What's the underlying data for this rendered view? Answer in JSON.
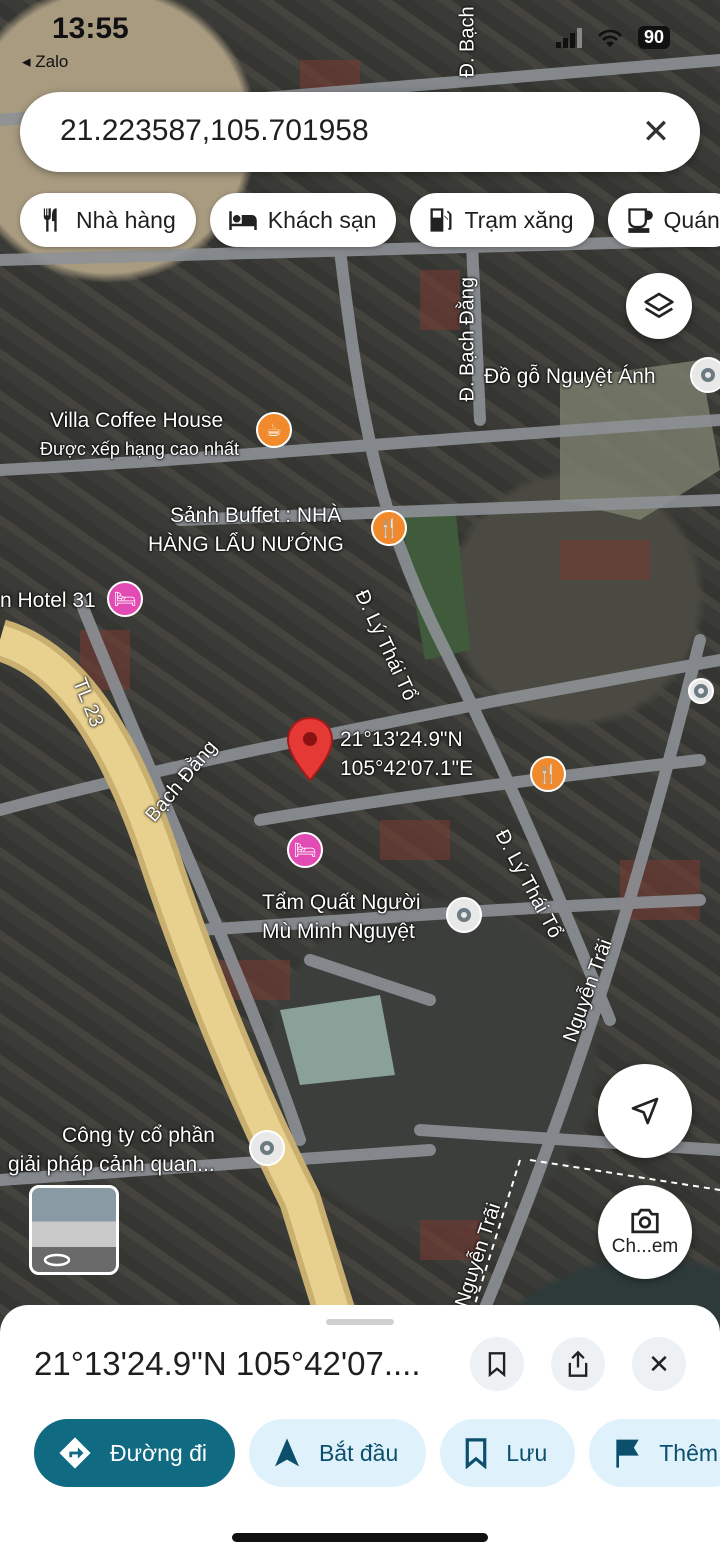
{
  "status_bar": {
    "time": "13:55",
    "back_app": "◂ Zalo",
    "battery": "90"
  },
  "search": {
    "query": "21.223587,105.701958"
  },
  "chips": [
    {
      "label": "Nhà hàng",
      "icon": "restaurant-icon"
    },
    {
      "label": "Khách sạn",
      "icon": "hotel-icon"
    },
    {
      "label": "Trạm xăng",
      "icon": "gas-station-icon"
    },
    {
      "label": "Quán",
      "icon": "cafe-icon"
    }
  ],
  "map": {
    "pin_label": [
      "21°13'24.9\"N",
      "105°42'07.1\"E"
    ],
    "places": [
      {
        "name": "Villa Coffee House",
        "sub": "Được xếp hạng cao nhất"
      },
      {
        "name": "Sảnh Buffet : NHÀ",
        "sub": "HÀNG LẨU NƯỚNG"
      },
      {
        "name": "n Hotel 31"
      },
      {
        "name": "Đồ gỗ Nguyệt Ánh"
      },
      {
        "name": "Tẩm Quất Người",
        "sub": "Mù Minh Nguyệt"
      },
      {
        "name": "Công ty cổ phần",
        "sub": "giải pháp cảnh quan..."
      }
    ],
    "roads": {
      "bach_dang_top": "Đ. Bạch Đằng",
      "bach_dang_top2": "Đ. Bạch",
      "ly_thai_to_1": "Đ. Lý Thái Tổ",
      "ly_thai_to_2": "Đ. Lý Thái Tổ",
      "tl23": "TL 23",
      "bach_dang": "Bạch Đằng",
      "nguyen_trai_1": "Nguyễn Trãi",
      "nguyen_trai_2": "Nguyễn Trãi"
    }
  },
  "lens_label": "Ch...em",
  "sheet": {
    "title": "21°13'24.9\"N 105°42'07....",
    "actions": [
      {
        "label": "Đường đi",
        "icon": "directions-icon"
      },
      {
        "label": "Bắt đầu",
        "icon": "navigation-icon"
      },
      {
        "label": "Lưu",
        "icon": "bookmark-icon"
      },
      {
        "label": "Thêm",
        "icon": "flag-icon"
      }
    ]
  },
  "colors": {
    "accent": "#0f6a82",
    "action_bg": "#dff2fb",
    "pin": "#e53935"
  }
}
